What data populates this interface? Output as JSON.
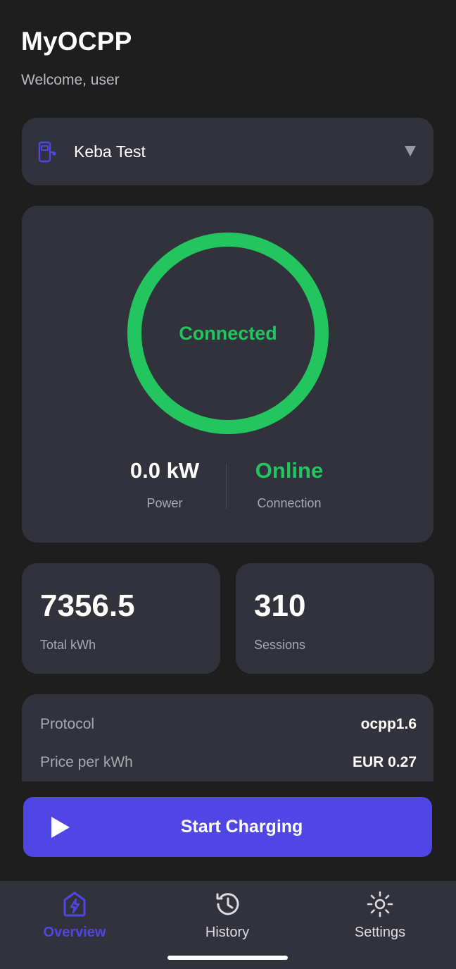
{
  "header": {
    "app_title": "MyOCPP",
    "welcome": "Welcome, user"
  },
  "charger": {
    "selected": "Keba Test",
    "icon": "charger-icon"
  },
  "status": {
    "ring_label": "Connected",
    "power_value": "0.0 kW",
    "power_label": "Power",
    "connection_value": "Online",
    "connection_label": "Connection"
  },
  "stats": {
    "total_kwh_value": "7356.5",
    "total_kwh_label": "Total kWh",
    "sessions_value": "310",
    "sessions_label": "Sessions"
  },
  "info": {
    "rows": [
      {
        "key": "Protocol",
        "value": "ocpp1.6"
      },
      {
        "key": "Price per kWh",
        "value": "EUR 0.27"
      }
    ]
  },
  "actions": {
    "start_label": "Start Charging"
  },
  "nav": {
    "items": [
      {
        "label": "Overview",
        "icon": "bolt-house-icon",
        "active": true
      },
      {
        "label": "History",
        "icon": "history-icon",
        "active": false
      },
      {
        "label": "Settings",
        "icon": "sun-gear-icon",
        "active": false
      }
    ]
  },
  "colors": {
    "background": "#1e1e1f",
    "card": "#32323c",
    "accent": "#5046e5",
    "success": "#22c55e",
    "muted_text": "#a8a8b0"
  }
}
